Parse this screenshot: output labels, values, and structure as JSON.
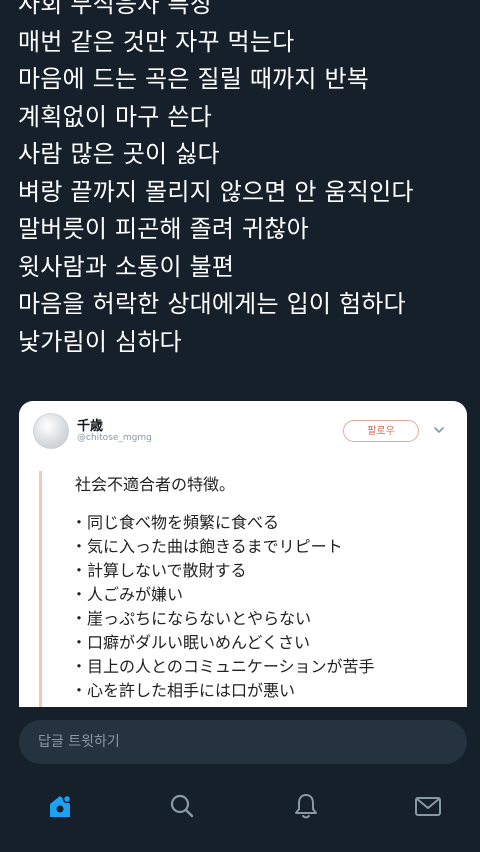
{
  "tweet": {
    "lines": [
      "사회 부적응자 특징",
      "매번 같은 것만 자꾸 먹는다",
      "마음에 드는 곡은 질릴 때까지 반복",
      "계획없이 마구 쓴다",
      "사람 많은 곳이 싫다",
      "벼랑 끝까지 몰리지 않으면 안 움직인다",
      "말버릇이 피곤해 졸려 귀찮아",
      "윗사람과 소통이 불편",
      "마음을 허락한 상대에게는 입이 험하다",
      "낯가림이 심하다"
    ]
  },
  "quoted": {
    "name": "千歳",
    "handle": "@chitose_mgmg",
    "follow_label": "팔로우",
    "title": "社会不適合者の特徴。",
    "items": [
      "・同じ食べ物を頻繁に食べる",
      "・気に入った曲は飽きるまでリピート",
      "・計算しないで散財する",
      "・人ごみが嫌い",
      "・崖っぷちにならないとやらない",
      "・口癖がダルい眠いめんどくさい",
      "・目上の人とのコミュニケーションが苦手",
      "・心を許した相手には口が悪い"
    ]
  },
  "reply": {
    "placeholder": "답글 트윗하기"
  },
  "nav": {
    "accent": "#1da1f2",
    "icons": [
      "home-icon",
      "search-icon",
      "notifications-icon",
      "messages-icon"
    ]
  }
}
